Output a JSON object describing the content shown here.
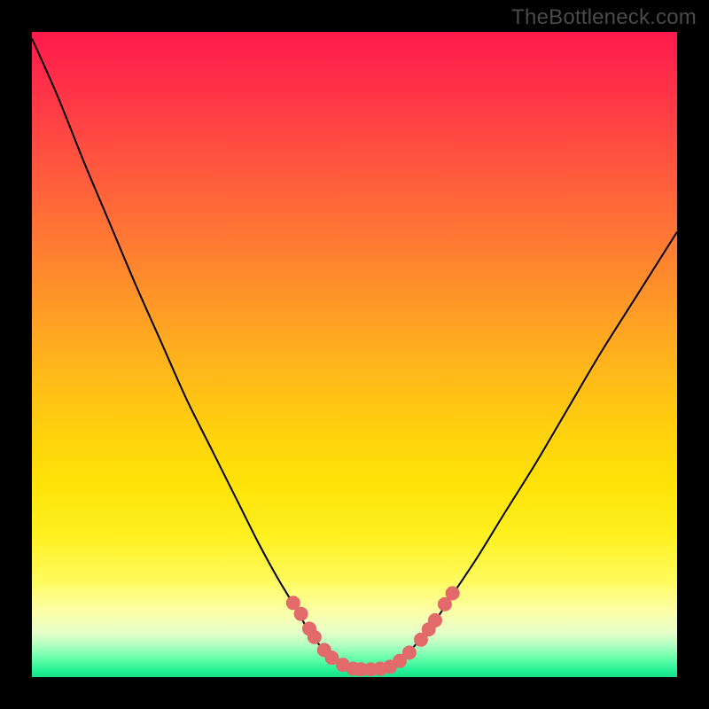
{
  "watermark": "TheBottleneck.com",
  "chart_data": {
    "type": "line",
    "title": "",
    "xlabel": "",
    "ylabel": "",
    "xlim": [
      0,
      100
    ],
    "ylim": [
      0,
      100
    ],
    "series": [
      {
        "name": "left-curve",
        "x": [
          0,
          4,
          8,
          12,
          16,
          20,
          24,
          28,
          32,
          35,
          38,
          41,
          43,
          45,
          47,
          49
        ],
        "y": [
          99,
          90,
          80,
          70.5,
          61,
          52,
          43,
          35,
          27,
          21,
          15.5,
          10.5,
          7,
          4.5,
          2.5,
          1.5
        ]
      },
      {
        "name": "valley-floor",
        "x": [
          49,
          51,
          53,
          55
        ],
        "y": [
          1.5,
          1.2,
          1.2,
          1.5
        ]
      },
      {
        "name": "right-curve",
        "x": [
          55,
          57,
          59,
          62,
          65,
          69,
          73,
          78,
          83,
          88,
          94,
          100
        ],
        "y": [
          1.5,
          2.5,
          4.5,
          8,
          12.5,
          18.5,
          25,
          33,
          41.5,
          50,
          59.5,
          69
        ]
      }
    ],
    "markers": {
      "name": "highlighted-points",
      "color": "#e26a6a",
      "radius_pct": 1.1,
      "points": [
        {
          "x": 40.5,
          "y": 11.5
        },
        {
          "x": 41.7,
          "y": 9.8
        },
        {
          "x": 43.0,
          "y": 7.5
        },
        {
          "x": 43.8,
          "y": 6.2
        },
        {
          "x": 45.3,
          "y": 4.2
        },
        {
          "x": 46.5,
          "y": 3.0
        },
        {
          "x": 48.2,
          "y": 1.9
        },
        {
          "x": 49.8,
          "y": 1.3
        },
        {
          "x": 51.0,
          "y": 1.2
        },
        {
          "x": 52.5,
          "y": 1.2
        },
        {
          "x": 54.0,
          "y": 1.3
        },
        {
          "x": 55.5,
          "y": 1.6
        },
        {
          "x": 57.0,
          "y": 2.5
        },
        {
          "x": 58.5,
          "y": 3.8
        },
        {
          "x": 60.3,
          "y": 5.8
        },
        {
          "x": 61.5,
          "y": 7.4
        },
        {
          "x": 62.5,
          "y": 8.8
        },
        {
          "x": 64.0,
          "y": 11.3
        },
        {
          "x": 65.2,
          "y": 13.0
        }
      ]
    },
    "gradient_bands": [
      {
        "pct": 0,
        "color": "#ff1a4d"
      },
      {
        "pct": 50,
        "color": "#ffb31a"
      },
      {
        "pct": 80,
        "color": "#fff94d"
      },
      {
        "pct": 97,
        "color": "#4dff9e"
      },
      {
        "pct": 100,
        "color": "#18e08a"
      }
    ]
  }
}
